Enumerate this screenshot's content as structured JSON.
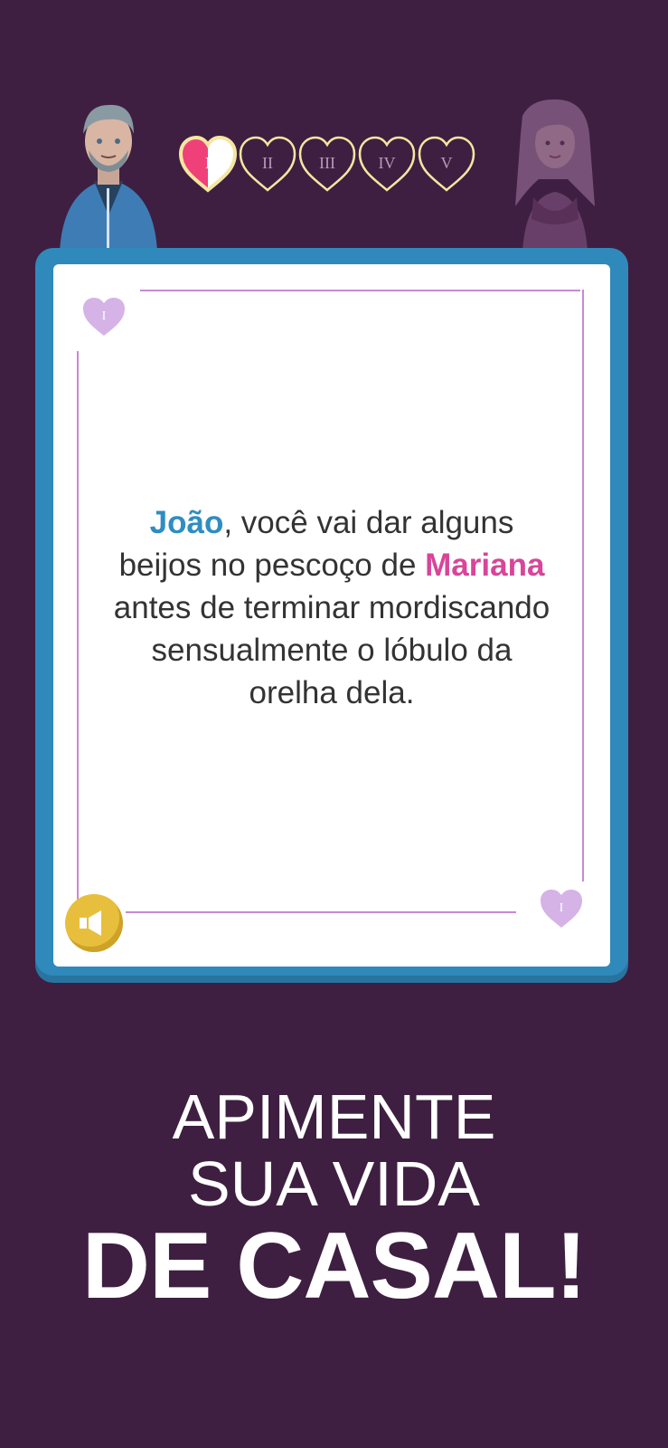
{
  "header": {
    "levels": [
      {
        "label": "I",
        "state": "half-filled"
      },
      {
        "label": "II",
        "state": "empty"
      },
      {
        "label": "III",
        "state": "empty"
      },
      {
        "label": "IV",
        "state": "empty"
      },
      {
        "label": "V",
        "state": "empty"
      }
    ],
    "male_avatar": "man-avatar",
    "female_avatar": "woman-avatar"
  },
  "card": {
    "level_badge": "I",
    "prompt": {
      "player1": "João",
      "part1": ", você vai dar alguns beijos no pescoço de ",
      "player2": "Mariana",
      "part2": " antes de terminar mordiscando sensualmente o lóbulo da orelha dela."
    },
    "sound_icon": "speaker-icon"
  },
  "tagline": {
    "line1": "APIMENTE",
    "line2": "SUA VIDA",
    "line3": "DE CASAL!"
  },
  "colors": {
    "background": "#3e1f41",
    "card_frame": "#2f89bb",
    "player1": "#2e8dc1",
    "player2": "#d8459a",
    "heart_active": "#f0407a",
    "heart_outline": "#f5e6a0",
    "sound_button": "#e7bf3c"
  }
}
